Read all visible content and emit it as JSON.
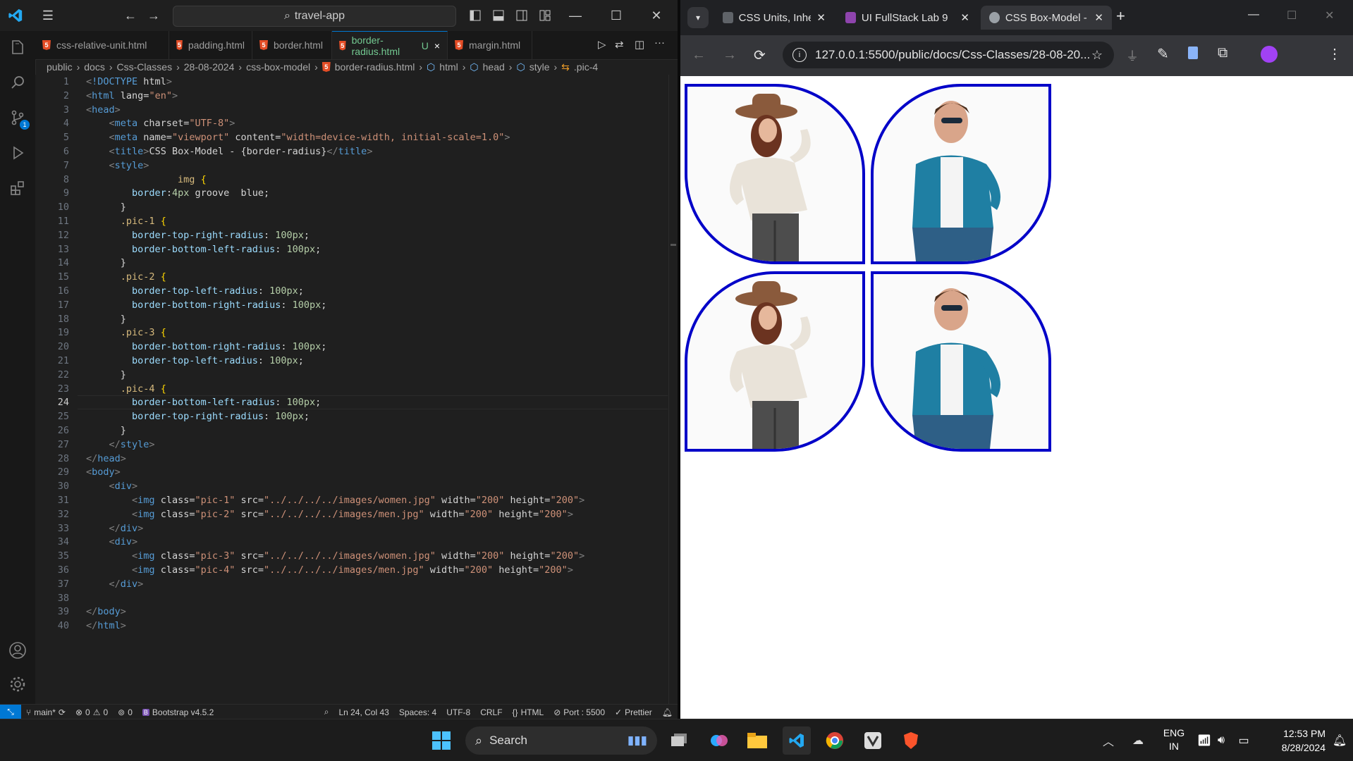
{
  "vscode": {
    "command_center": "travel-app",
    "tabs": [
      {
        "label": "css-relative-unit.html"
      },
      {
        "label": "padding.html"
      },
      {
        "label": "border.html"
      },
      {
        "label": "border-radius.html",
        "badge": "U",
        "close": "×"
      },
      {
        "label": "margin.html"
      }
    ],
    "breadcrumbs": [
      "public",
      "docs",
      "Css-Classes",
      "28-08-2024",
      "css-box-model",
      "border-radius.html",
      "html",
      "head",
      "style",
      ".pic-4"
    ],
    "scm_badge": "1",
    "code_lines": [
      "<!DOCTYPE html>",
      "<html lang=\"en\">",
      "<head>",
      "    <meta charset=\"UTF-8\">",
      "    <meta name=\"viewport\" content=\"width=device-width, initial-scale=1.0\">",
      "    <title>CSS Box-Model - {border-radius}</title>",
      "    <style>",
      "                img {",
      "        border:4px groove  blue;",
      "      }",
      "      .pic-1 {",
      "        border-top-right-radius: 100px;",
      "        border-bottom-left-radius: 100px;",
      "      }",
      "      .pic-2 {",
      "        border-top-left-radius: 100px;",
      "        border-bottom-right-radius: 100px;",
      "      }",
      "      .pic-3 {",
      "        border-bottom-right-radius: 100px;",
      "        border-top-left-radius: 100px;",
      "      }",
      "      .pic-4 {",
      "        border-bottom-left-radius: 100px;",
      "        border-top-right-radius: 100px;",
      "      }",
      "    </style>",
      "</head>",
      "<body>",
      "    <div>",
      "        <img class=\"pic-1\" src=\"../../../../images/women.jpg\" width=\"200\" height=\"200\">",
      "        <img class=\"pic-2\" src=\"../../../../images/men.jpg\" width=\"200\" height=\"200\">",
      "    </div>",
      "    <div>",
      "        <img class=\"pic-3\" src=\"../../../../images/women.jpg\" width=\"200\" height=\"200\">",
      "        <img class=\"pic-4\" src=\"../../../../images/men.jpg\" width=\"200\" height=\"200\">",
      "    </div>",
      "",
      "</body>",
      "</html>"
    ],
    "current_line": 24,
    "status": {
      "branch": "main*",
      "errors": "0",
      "warnings": "0",
      "ports": "0",
      "bootstrap": "Bootstrap v4.5.2",
      "position": "Ln 24, Col 43",
      "spaces": "Spaces: 4",
      "encoding": "UTF-8",
      "eol": "CRLF",
      "language": "HTML",
      "port": "Port : 5500",
      "prettier": "Prettier"
    }
  },
  "chrome": {
    "tabs": [
      {
        "label": "CSS Units, Inherita",
        "fav_color": "#9aa0a6"
      },
      {
        "label": "UI FullStack Lab 9",
        "fav_color": "#8e44ad"
      },
      {
        "label": "CSS Box-Model - {",
        "fav_color": "#9aa0a6"
      }
    ],
    "url": "127.0.0.1:5500/public/docs/Css-Classes/28-08-20...",
    "images": [
      {
        "class": "pic-1",
        "subject": "women"
      },
      {
        "class": "pic-2",
        "subject": "men"
      },
      {
        "class": "pic-3",
        "subject": "women"
      },
      {
        "class": "pic-4",
        "subject": "men"
      }
    ],
    "border_color": "#0000c8"
  },
  "taskbar": {
    "search_label": "Search",
    "lang_top": "ENG",
    "lang_bottom": "IN",
    "time": "12:53 PM",
    "date": "8/28/2024"
  }
}
